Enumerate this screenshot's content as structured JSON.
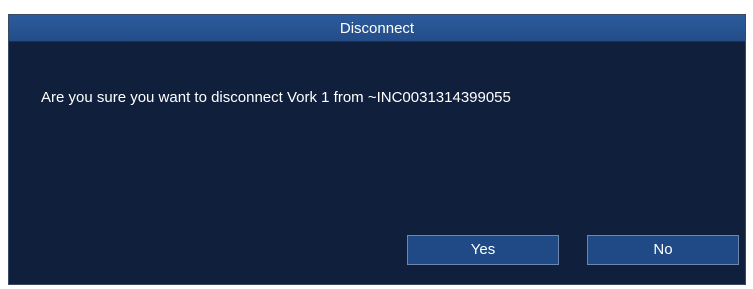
{
  "dialog": {
    "title": "Disconnect",
    "message": "Are you sure you want to disconnect Vork 1 from ~INC0031314399055",
    "yes_label": "Yes",
    "no_label": "No"
  },
  "colors": {
    "background": "#0f1f3c",
    "title_bar": "#2a5796",
    "button": "#1f4a86",
    "text": "#ffffff"
  }
}
